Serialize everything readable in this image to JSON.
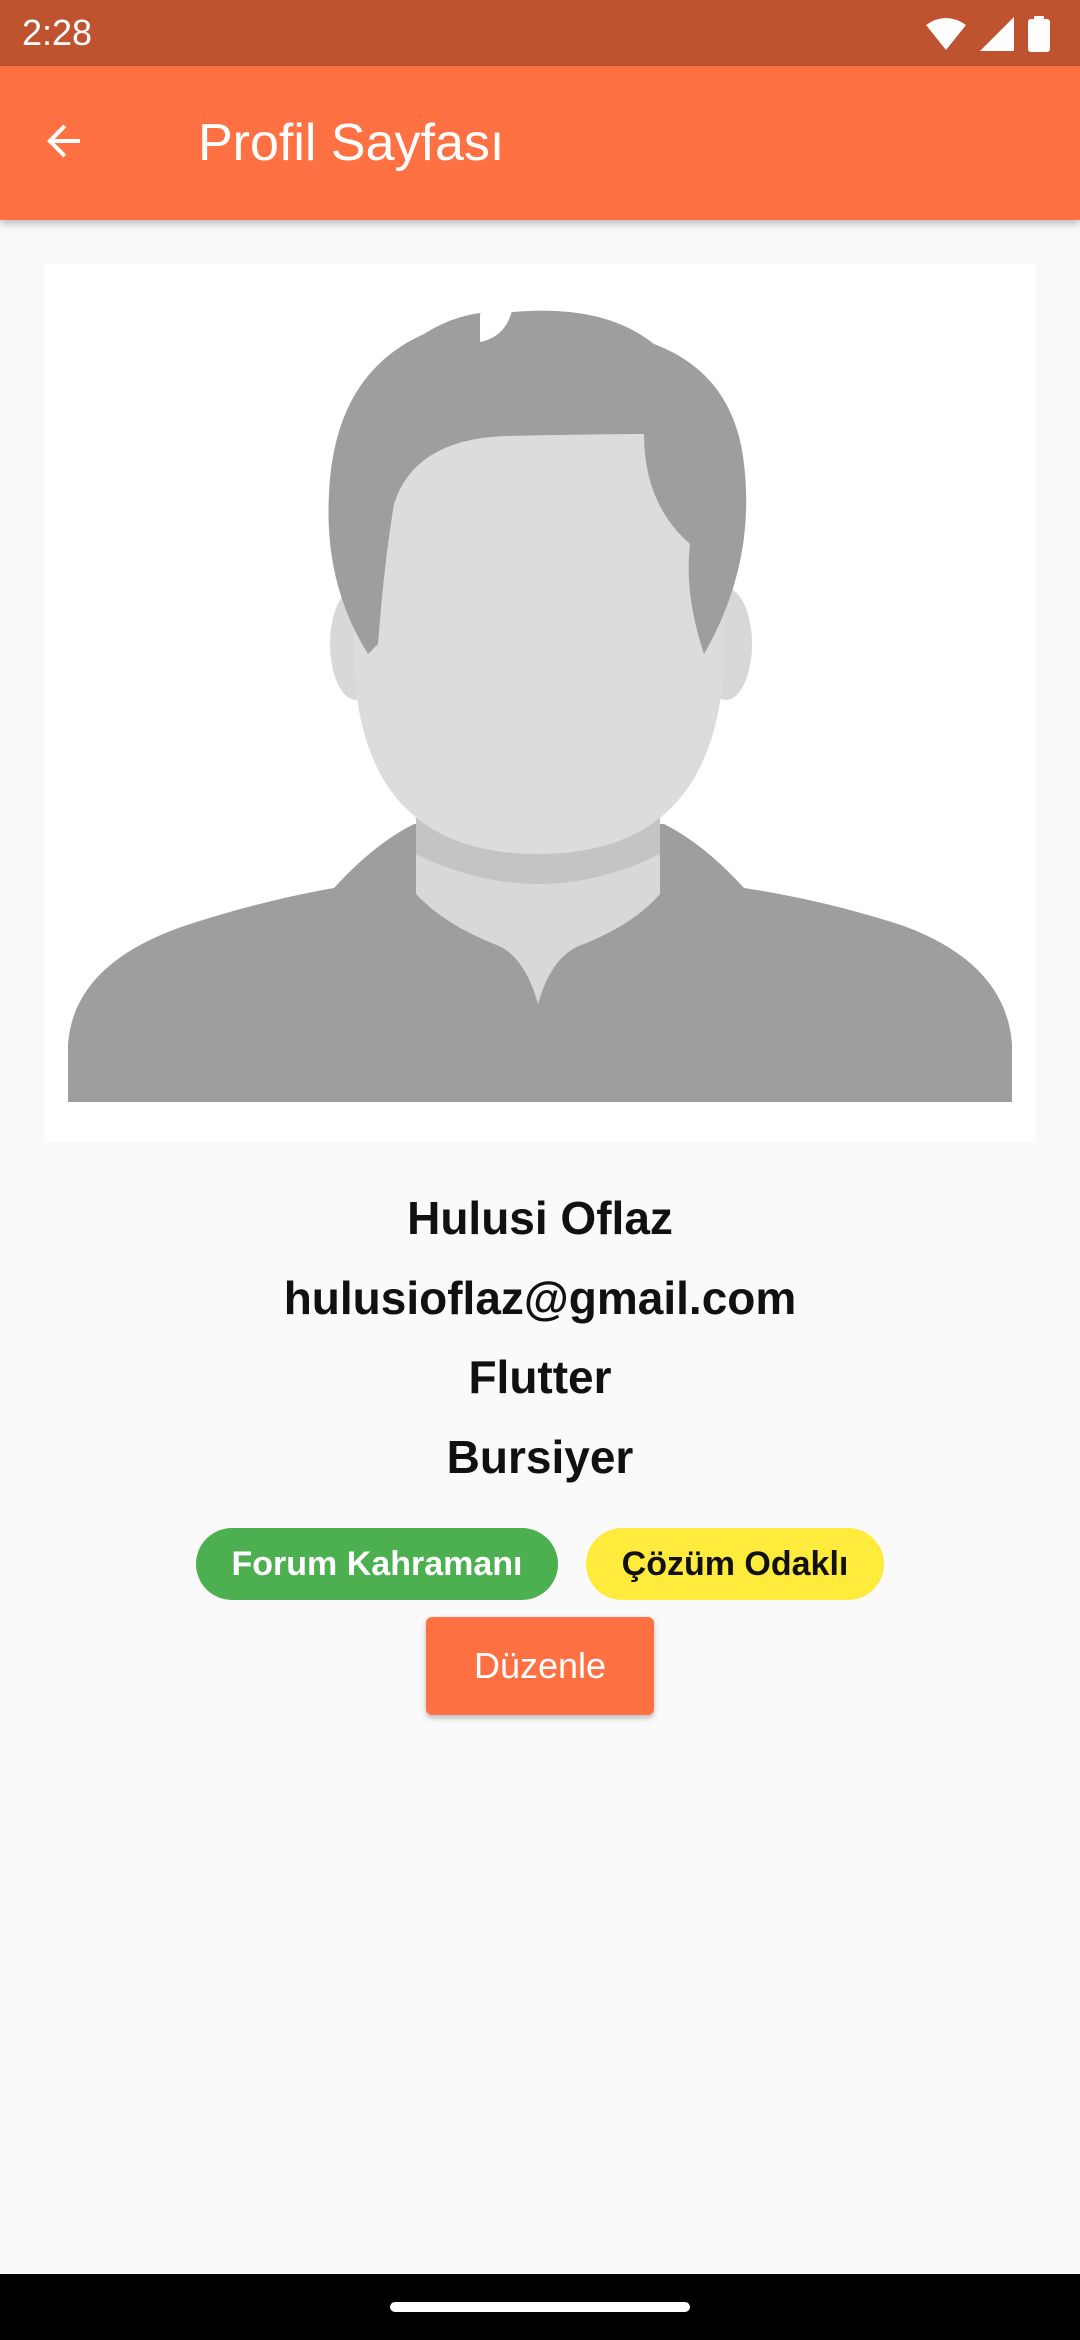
{
  "status_bar": {
    "time": "2:28",
    "icons": [
      "wifi-icon",
      "signal-icon",
      "battery-icon"
    ]
  },
  "app_bar": {
    "title": "Profil Sayfası",
    "back_icon": "arrow-back-icon"
  },
  "profile": {
    "avatar_icon": "default-avatar-silhouette",
    "name": "Hulusi Oflaz",
    "email": "hulusioflaz@gmail.com",
    "department": "Flutter",
    "role": "Bursiyer"
  },
  "badges": [
    {
      "label": "Forum Kahramanı",
      "color": "#4caf50"
    },
    {
      "label": "Çözüm Odaklı",
      "color": "#ffeb3b"
    }
  ],
  "edit_button": {
    "label": "Düzenle"
  },
  "colors": {
    "status_bar": "#bf5330",
    "app_bar": "#ff7043",
    "background": "#fafafa"
  }
}
